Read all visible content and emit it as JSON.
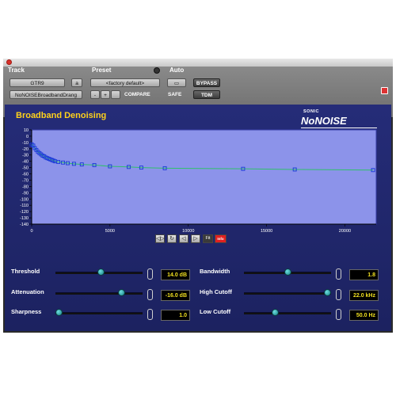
{
  "header": {
    "sections": {
      "track": "Track",
      "preset": "Preset",
      "auto": "Auto"
    },
    "track_name": "GTR9",
    "track_button": "a",
    "insert_name": "NoNOISEBroadbandDrang",
    "preset_name": "<factory default>",
    "compare_label": "COMPARE",
    "bypass_label": "BYPASS",
    "safe_label": "SAFE",
    "tdm_label": "TDM",
    "nav_minus": "-",
    "nav_plus": "+"
  },
  "plugin": {
    "title": "Broadband Denoising",
    "logo_top": "SONIC",
    "logo_main": "NoNOISE"
  },
  "chart_data": {
    "type": "line",
    "x": [
      0,
      100,
      200,
      300,
      400,
      500,
      600,
      700,
      800,
      900,
      1000,
      1100,
      1200,
      1300,
      1400,
      1500,
      1700,
      2000,
      2300,
      2700,
      3200,
      4000,
      5000,
      6200,
      7000,
      8500,
      13500,
      16800,
      21800
    ],
    "y": [
      -13,
      -15,
      -19,
      -22,
      -25,
      -27,
      -29,
      -31,
      -32,
      -34,
      -35,
      -36,
      -37,
      -38,
      -39,
      -40,
      -41,
      -42,
      -43,
      -44,
      -45,
      -46,
      -48,
      -49,
      -50,
      -51,
      -52,
      -53,
      -54
    ],
    "xlim": [
      0,
      22000
    ],
    "ylim": [
      -140,
      10
    ],
    "x_ticks": [
      "0",
      "5000",
      "10000",
      "15000",
      "20000"
    ],
    "y_ticks": [
      "10",
      "0",
      "-10",
      "-20",
      "-30",
      "-40",
      "-50",
      "-60",
      "-70",
      "-80",
      "-90",
      "-100",
      "-110",
      "-120",
      "-130",
      "-140"
    ],
    "grid": false,
    "line_color": "#2fc06a",
    "marker_color": "#1a3ad8",
    "background": "#8c93ea"
  },
  "transport_buttons": [
    "◁▷",
    "↻",
    "◁",
    "▷",
    "Fit",
    "Info"
  ],
  "controls": {
    "threshold": {
      "label": "Threshold",
      "value": "14.0 dB",
      "level": 0.52
    },
    "attenuation": {
      "label": "Attenuation",
      "value": "-16.0 dB",
      "level": 0.78
    },
    "sharpness": {
      "label": "Sharpness",
      "value": "1.0",
      "level": 0.0
    },
    "bandwidth": {
      "label": "Bandwidth",
      "value": "1.8",
      "level": 0.5
    },
    "high_cutoff": {
      "label": "High Cutoff",
      "value": "22.0 kHz",
      "level": 1.0
    },
    "low_cutoff": {
      "label": "Low Cutoff",
      "value": "50.0 Hz",
      "level": 0.35
    }
  }
}
